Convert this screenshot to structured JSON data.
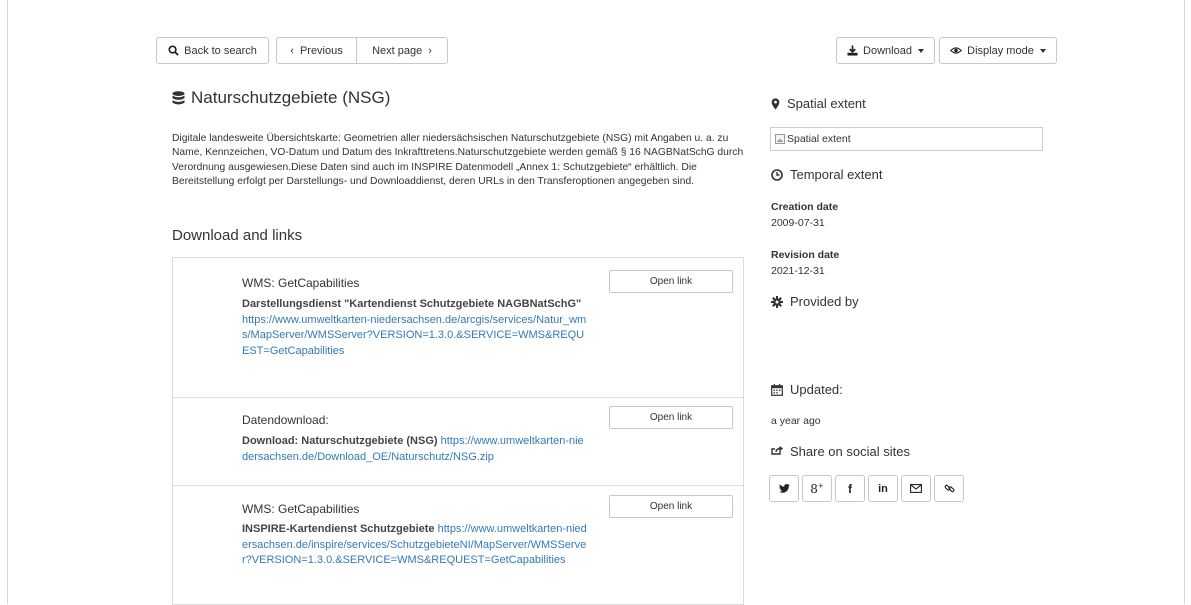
{
  "toolbar": {
    "back_label": "Back to search",
    "previous_label": "Previous",
    "next_label": "Next page",
    "download_label": "Download",
    "display_mode_label": "Display mode"
  },
  "record": {
    "title": "Naturschutzgebiete (NSG)",
    "description": "Digitale landesweite Übersichtskarte: Geometrien aller niedersächsischen Naturschutzgebiete (NSG) mit Angaben u. a. zu Name, Kennzeichen, VO-Datum und Datum des Inkrafttretens.Naturschutzgebiete werden gemäß § 16 NAGBNatSchG durch Verordnung ausgewiesen.Diese Daten sind auch im INSPIRE Datenmodell „Annex 1: Schutzgebiete“ erhältlich. Die Bereitstellung erfolgt per Darstellungs- und Downloaddienst, deren URLs in den Transferoptionen angegeben sind."
  },
  "links_section": {
    "heading": "Download and links",
    "open_label": "Open link",
    "items": [
      {
        "type": "WMS: GetCapabilities",
        "name": "Darstellungsdienst \"Kartendienst Schutzgebiete NAGBNatSchG\"",
        "url": "https://www.umweltkarten-niedersachsen.de/arcgis/services/Natur_wms/MapServer/WMSServer?VERSION=1.3.0.&SERVICE=WMS&REQUEST=GetCapabilities"
      },
      {
        "type": "Datendownload:",
        "name": "Download: Naturschutzgebiete (NSG)",
        "url": "https://www.umweltkarten-niedersachsen.de/Download_OE/Naturschutz/NSG.zip"
      },
      {
        "type": "WMS: GetCapabilities",
        "name": "INSPIRE-Kartendienst Schutzgebiete",
        "url": "https://www.umweltkarten-niedersachsen.de/inspire/services/SchutzgebieteNI/MapServer/WMSServer?VERSION=1.3.0.&SERVICE=WMS&REQUEST=GetCapabilities"
      }
    ]
  },
  "sidebar": {
    "spatial_extent_heading": "Spatial extent",
    "spatial_extent_image_alt": "Spatial extent",
    "temporal_extent_heading": "Temporal extent",
    "creation_date_label": "Creation date",
    "creation_date": "2009-07-31",
    "revision_date_label": "Revision date",
    "revision_date": "2021-12-31",
    "provided_by_heading": "Provided by",
    "updated_heading": "Updated:",
    "updated_value": "a year ago",
    "share_heading": "Share on social sites",
    "social_buttons": [
      "twitter-icon",
      "google-plus-icon",
      "facebook-icon",
      "linkedin-icon",
      "email-icon",
      "permalink-icon"
    ]
  }
}
